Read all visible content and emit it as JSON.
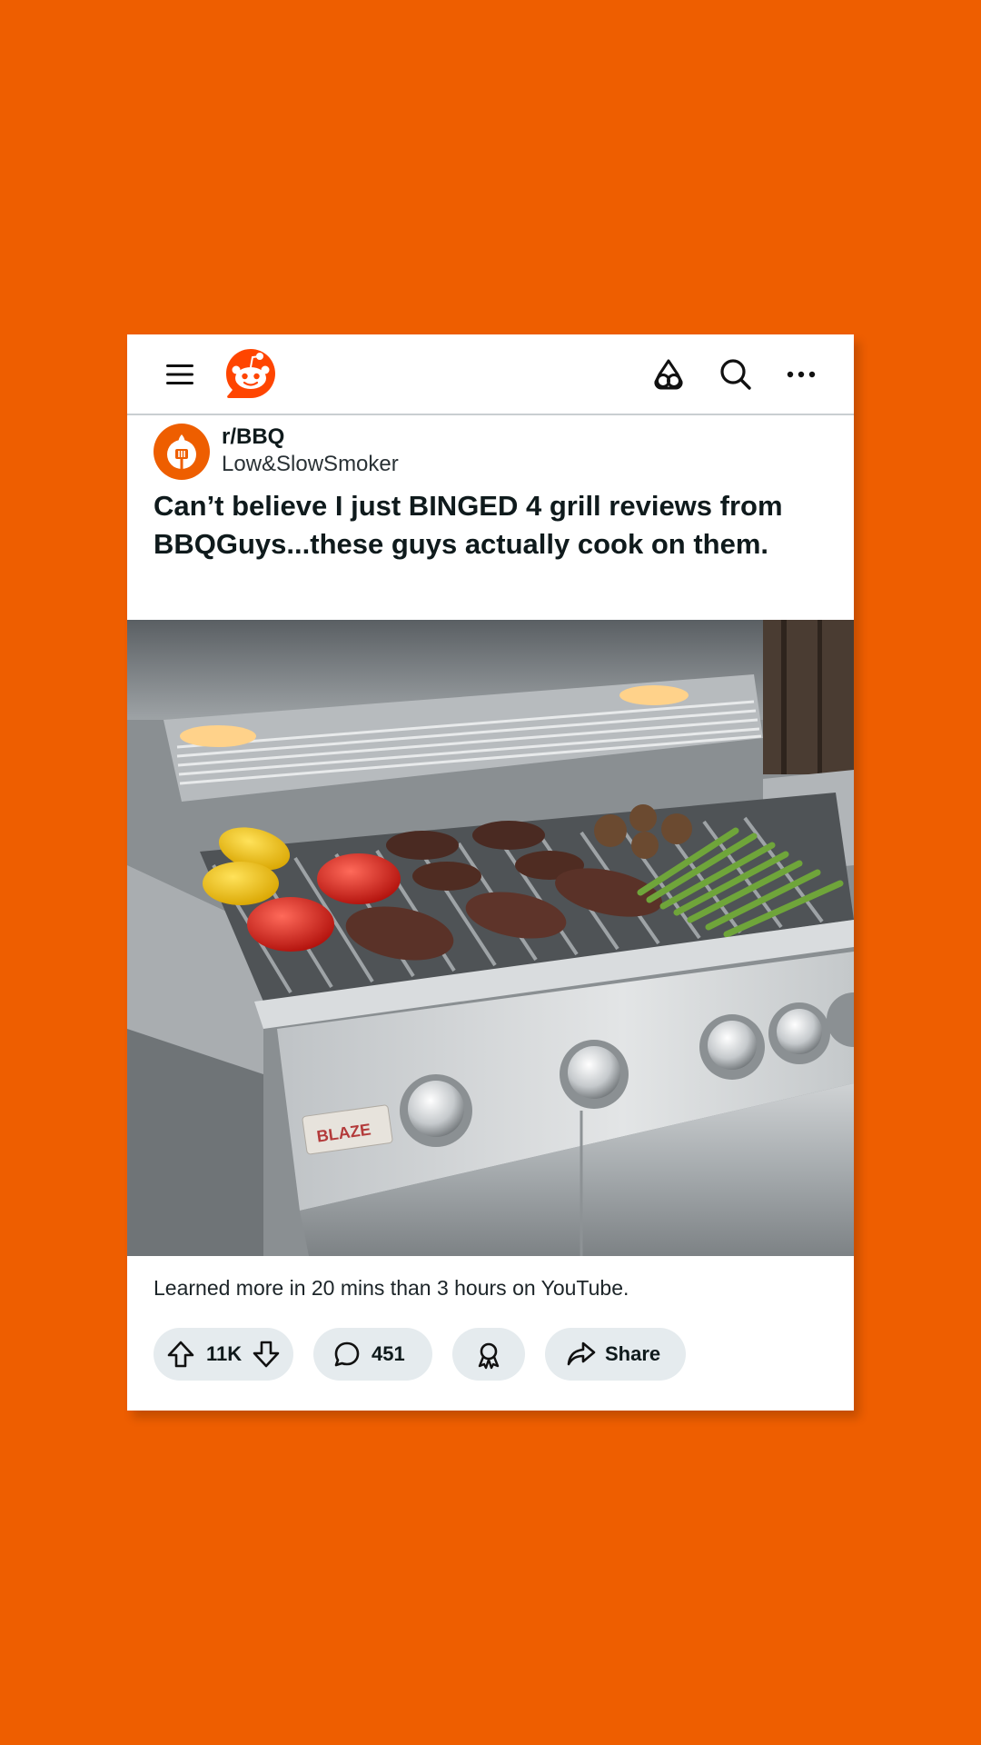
{
  "topbar": {
    "menu_icon": "hamburger-menu-icon",
    "logo": "reddit-logo",
    "icons": [
      "popular-icon",
      "search-icon",
      "more-icon"
    ]
  },
  "post": {
    "subreddit": "r/BBQ",
    "username": "Low&SlowSmoker",
    "title": "Can’t believe I just BINGED 4 grill reviews from BBQGuys...these guys actually cook on them.",
    "caption": "Learned more in 20 mins than 3 hours on YouTube.",
    "image_brand_label": "BLAZE"
  },
  "actions": {
    "votes": "11K",
    "comments": "451",
    "share_label": "Share"
  },
  "colors": {
    "background": "#EE5E00",
    "reddit_orange": "#FF4500",
    "pill_bg": "#E5EBEE"
  }
}
